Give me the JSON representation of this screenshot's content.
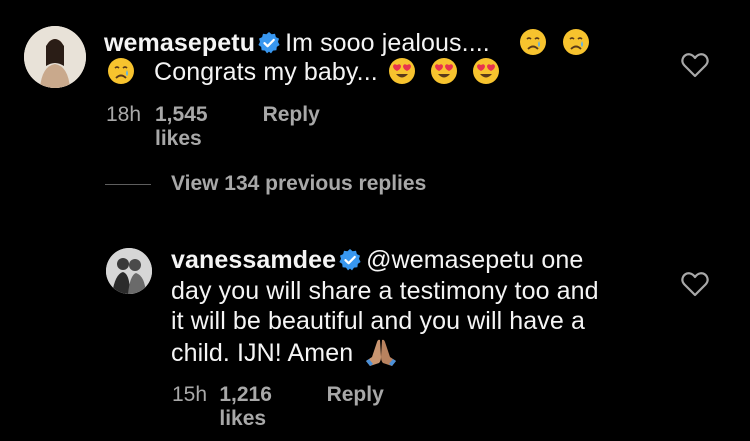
{
  "comment1": {
    "username": "wemasepetu",
    "text_line1": "Im sooo jealous....",
    "text_line2": "Congrats my baby...",
    "time": "18h",
    "likes": "1,545 likes",
    "reply": "Reply"
  },
  "view_replies": "View 134 previous replies",
  "comment2": {
    "username": "vanessamdee",
    "mention": "@wemasepetu",
    "text_line1_rest": "one",
    "text_line2": "day you will share a testimony too and",
    "text_line3": "it will be beautiful and you will have a",
    "text_line4": "child. IJN! Amen",
    "time": "15h",
    "likes": "1,216 likes",
    "reply": "Reply"
  },
  "colors": {
    "background": "#000000",
    "text": "#f5f5f5",
    "secondary": "#a8a8a8",
    "verified": "#3897f0"
  }
}
